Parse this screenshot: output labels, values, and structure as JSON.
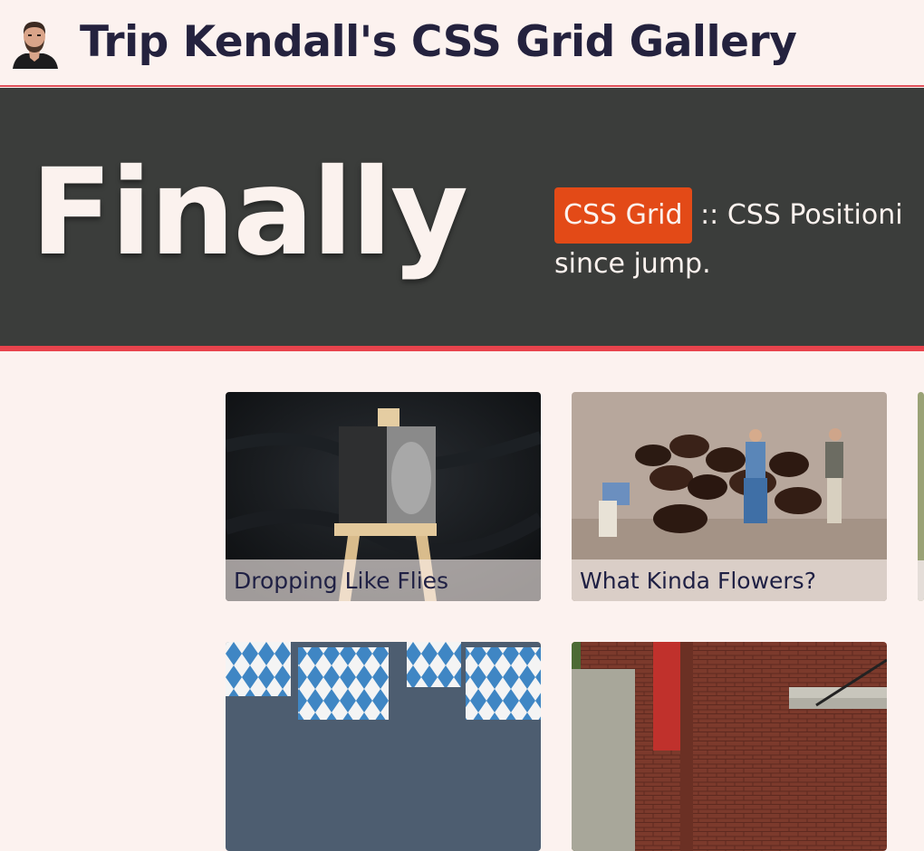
{
  "header": {
    "title": "Trip Kendall's CSS Grid Gallery"
  },
  "hero": {
    "title": "Finally",
    "badge": "CSS Grid",
    "text_line1": ":: CSS Positioni",
    "text_line2": "since jump."
  },
  "gallery": {
    "cards": [
      {
        "caption": "Dropping Like Flies"
      },
      {
        "caption": "What Kinda Flowers?"
      },
      {
        "caption": ""
      },
      {
        "caption": ""
      },
      {
        "caption": ""
      }
    ]
  },
  "colors": {
    "background": "#fcf2ef",
    "hero_bg": "#3b3d3b",
    "accent_red": "#e8434c",
    "badge_orange": "#e34a17",
    "title_text": "#24223e"
  }
}
